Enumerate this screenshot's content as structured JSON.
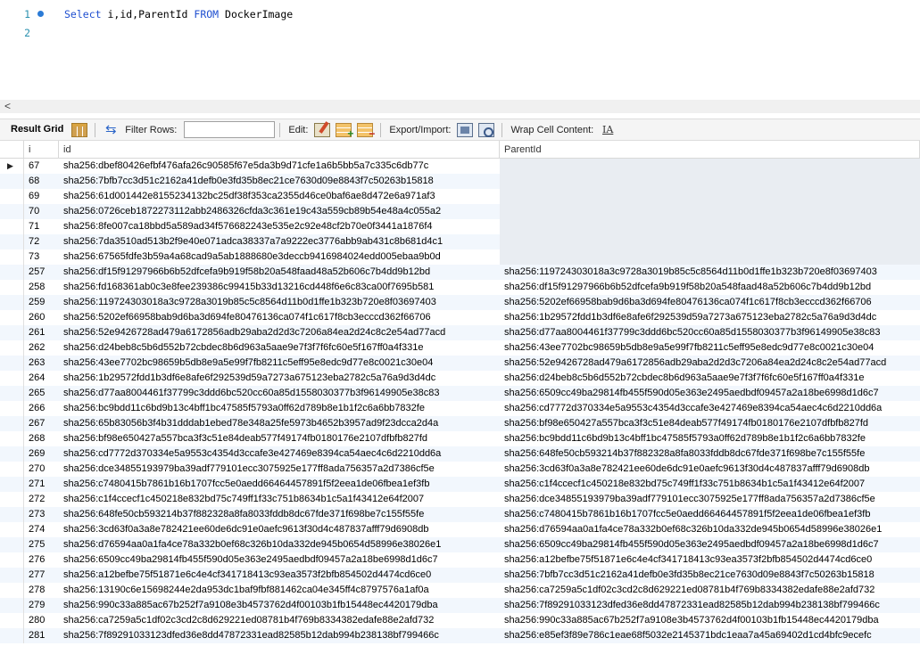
{
  "editor": {
    "lines": [
      {
        "number": "1",
        "has_marker": true,
        "tokens": [
          {
            "text": "Select",
            "kind": "kw"
          },
          {
            "text": " i,id,ParentId ",
            "kind": "id"
          },
          {
            "text": "FROM",
            "kind": "kw"
          },
          {
            "text": " DockerImage",
            "kind": "id"
          }
        ]
      },
      {
        "number": "2",
        "has_marker": false,
        "tokens": []
      }
    ]
  },
  "scroll": {
    "left_arrow": "<"
  },
  "toolbar": {
    "result_grid_label": "Result Grid",
    "filter_rows_label": "Filter Rows:",
    "filter_rows_value": "",
    "edit_label": "Edit:",
    "export_import_label": "Export/Import:",
    "wrap_cell_label": "Wrap Cell Content:",
    "wrap_icon_glyph": "IA"
  },
  "grid": {
    "columns": [
      "i",
      "id",
      "ParentId"
    ],
    "selected_row_marker": "▶",
    "rows": [
      {
        "i": "67",
        "id": "sha256:dbef80426efbf476afa26c90585f67e5da3b9d71cfe1a6b5bb5a7c335c6db77c",
        "parent": null
      },
      {
        "i": "68",
        "id": "sha256:7bfb7cc3d51c2162a41defb0e3fd35b8ec21ce7630d09e8843f7c50263b15818",
        "parent": null
      },
      {
        "i": "69",
        "id": "sha256:61d001442e8155234132bc25df38f353ca2355d46ce0baf6ae8d472e6a971af3",
        "parent": null
      },
      {
        "i": "70",
        "id": "sha256:0726ceb1872273112abb2486326cfda3c361e19c43a559cb89b54e48a4c055a2",
        "parent": null
      },
      {
        "i": "71",
        "id": "sha256:8fe007ca18bbd5a589ad34f576682243e535e2c92e48cf2b70e0f3441a1876f4",
        "parent": null
      },
      {
        "i": "72",
        "id": "sha256:7da3510ad513b2f9e40e071adca38337a7a9222ec3776abb9ab431c8b681d4c1",
        "parent": null
      },
      {
        "i": "73",
        "id": "sha256:67565fdfe3b59a4a68cad9a5ab1888680e3deccb9416984024edd005ebaa9b0d",
        "parent": null
      },
      {
        "i": "257",
        "id": "sha256:df15f91297966b6b52dfcefa9b919f58b20a548faad48a52b606c7b4dd9b12bd",
        "parent": "sha256:119724303018a3c9728a3019b85c5c8564d11b0d1ffe1b323b720e8f03697403"
      },
      {
        "i": "258",
        "id": "sha256:fd168361ab0c3e8fee239386c99415b33d13216cd448f6e6c83ca00f7695b581",
        "parent": "sha256:df15f91297966b6b52dfcefa9b919f58b20a548faad48a52b606c7b4dd9b12bd"
      },
      {
        "i": "259",
        "id": "sha256:119724303018a3c9728a3019b85c5c8564d11b0d1ffe1b323b720e8f03697403",
        "parent": "sha256:5202ef66958bab9d6ba3d694fe80476136ca074f1c617f8cb3ecccd362f66706"
      },
      {
        "i": "260",
        "id": "sha256:5202ef66958bab9d6ba3d694fe80476136ca074f1c617f8cb3ecccd362f66706",
        "parent": "sha256:1b29572fdd1b3df6e8afe6f292539d59a7273a675123eba2782c5a76a9d3d4dc"
      },
      {
        "i": "261",
        "id": "sha256:52e9426728ad479a6172856adb29aba2d2d3c7206a84ea2d24c8c2e54ad77acd",
        "parent": "sha256:d77aa8004461f37799c3ddd6bc520cc60a85d1558030377b3f96149905e38c83"
      },
      {
        "i": "262",
        "id": "sha256:d24beb8c5b6d552b72cbdec8b6d963a5aae9e7f3f7f6fc60e5f167ff0a4f331e",
        "parent": "sha256:43ee7702bc98659b5db8e9a5e99f7fb8211c5eff95e8edc9d77e8c0021c30e04"
      },
      {
        "i": "263",
        "id": "sha256:43ee7702bc98659b5db8e9a5e99f7fb8211c5eff95e8edc9d77e8c0021c30e04",
        "parent": "sha256:52e9426728ad479a6172856adb29aba2d2d3c7206a84ea2d24c8c2e54ad77acd"
      },
      {
        "i": "264",
        "id": "sha256:1b29572fdd1b3df6e8afe6f292539d59a7273a675123eba2782c5a76a9d3d4dc",
        "parent": "sha256:d24beb8c5b6d552b72cbdec8b6d963a5aae9e7f3f7f6fc60e5f167ff0a4f331e"
      },
      {
        "i": "265",
        "id": "sha256:d77aa8004461f37799c3ddd6bc520cc60a85d1558030377b3f96149905e38c83",
        "parent": "sha256:6509cc49ba29814fb455f590d05e363e2495aedbdf09457a2a18be6998d1d6c7"
      },
      {
        "i": "266",
        "id": "sha256:bc9bdd11c6bd9b13c4bff1bc47585f5793a0ff62d789b8e1b1f2c6a6bb7832fe",
        "parent": "sha256:cd7772d370334e5a9553c4354d3ccafe3e427469e8394ca54aec4c6d2210dd6a"
      },
      {
        "i": "267",
        "id": "sha256:65b83056b3f4b31dddab1ebed78e348a25fe5973b4652b3957ad9f23dcca2d4a",
        "parent": "sha256:bf98e650427a557bca3f3c51e84deab577f49174fb0180176e2107dfbfb827fd"
      },
      {
        "i": "268",
        "id": "sha256:bf98e650427a557bca3f3c51e84deab577f49174fb0180176e2107dfbfb827fd",
        "parent": "sha256:bc9bdd11c6bd9b13c4bff1bc47585f5793a0ff62d789b8e1b1f2c6a6bb7832fe"
      },
      {
        "i": "269",
        "id": "sha256:cd7772d370334e5a9553c4354d3ccafe3e427469e8394ca54aec4c6d2210dd6a",
        "parent": "sha256:648fe50cb593214b37f882328a8fa8033fddb8dc67fde371f698be7c155f55fe"
      },
      {
        "i": "270",
        "id": "sha256:dce34855193979ba39adf779101ecc3075925e177ff8ada756357a2d7386cf5e",
        "parent": "sha256:3cd63f0a3a8e782421ee60de6dc91e0aefc9613f30d4c487837afff79d6908db"
      },
      {
        "i": "271",
        "id": "sha256:c7480415b7861b16b1707fcc5e0aedd66464457891f5f2eea1de06fbea1ef3fb",
        "parent": "sha256:c1f4ccecf1c450218e832bd75c749ff1f33c751b8634b1c5a1f43412e64f2007"
      },
      {
        "i": "272",
        "id": "sha256:c1f4ccecf1c450218e832bd75c749ff1f33c751b8634b1c5a1f43412e64f2007",
        "parent": "sha256:dce34855193979ba39adf779101ecc3075925e177ff8ada756357a2d7386cf5e"
      },
      {
        "i": "273",
        "id": "sha256:648fe50cb593214b37f882328a8fa8033fddb8dc67fde371f698be7c155f55fe",
        "parent": "sha256:c7480415b7861b16b1707fcc5e0aedd66464457891f5f2eea1de06fbea1ef3fb"
      },
      {
        "i": "274",
        "id": "sha256:3cd63f0a3a8e782421ee60de6dc91e0aefc9613f30d4c487837afff79d6908db",
        "parent": "sha256:d76594aa0a1fa4ce78a332b0ef68c326b10da332de945b0654d58996e38026e1"
      },
      {
        "i": "275",
        "id": "sha256:d76594aa0a1fa4ce78a332b0ef68c326b10da332de945b0654d58996e38026e1",
        "parent": "sha256:6509cc49ba29814fb455f590d05e363e2495aedbdf09457a2a18be6998d1d6c7"
      },
      {
        "i": "276",
        "id": "sha256:6509cc49ba29814fb455f590d05e363e2495aedbdf09457a2a18be6998d1d6c7",
        "parent": "sha256:a12befbe75f51871e6c4e4cf341718413c93ea3573f2bfb854502d4474cd6ce0"
      },
      {
        "i": "277",
        "id": "sha256:a12befbe75f51871e6c4e4cf341718413c93ea3573f2bfb854502d4474cd6ce0",
        "parent": "sha256:7bfb7cc3d51c2162a41defb0e3fd35b8ec21ce7630d09e8843f7c50263b15818"
      },
      {
        "i": "278",
        "id": "sha256:13190c6e15698244e2da953dc1baf9fbf881462ca04e345ff4c8797576a1af0a",
        "parent": "sha256:ca7259a5c1df02c3cd2c8d629221ed08781b4f769b8334382edafe88e2afd732"
      },
      {
        "i": "279",
        "id": "sha256:990c33a885ac67b252f7a9108e3b4573762d4f00103b1fb15448ec4420179dba",
        "parent": "sha256:7f89291033123dfed36e8dd47872331ead82585b12dab994b238138bf799466c"
      },
      {
        "i": "280",
        "id": "sha256:ca7259a5c1df02c3cd2c8d629221ed08781b4f769b8334382edafe88e2afd732",
        "parent": "sha256:990c33a885ac67b252f7a9108e3b4573762d4f00103b1fb15448ec4420179dba"
      },
      {
        "i": "281",
        "id": "sha256:7f89291033123dfed36e8dd47872331ead82585b12dab994b238138bf799466c",
        "parent": "sha256:e85ef3f89e786c1eae68f5032e2145371bdc1eaa7a45a69402d1cd4bfc9ecefc"
      }
    ]
  }
}
